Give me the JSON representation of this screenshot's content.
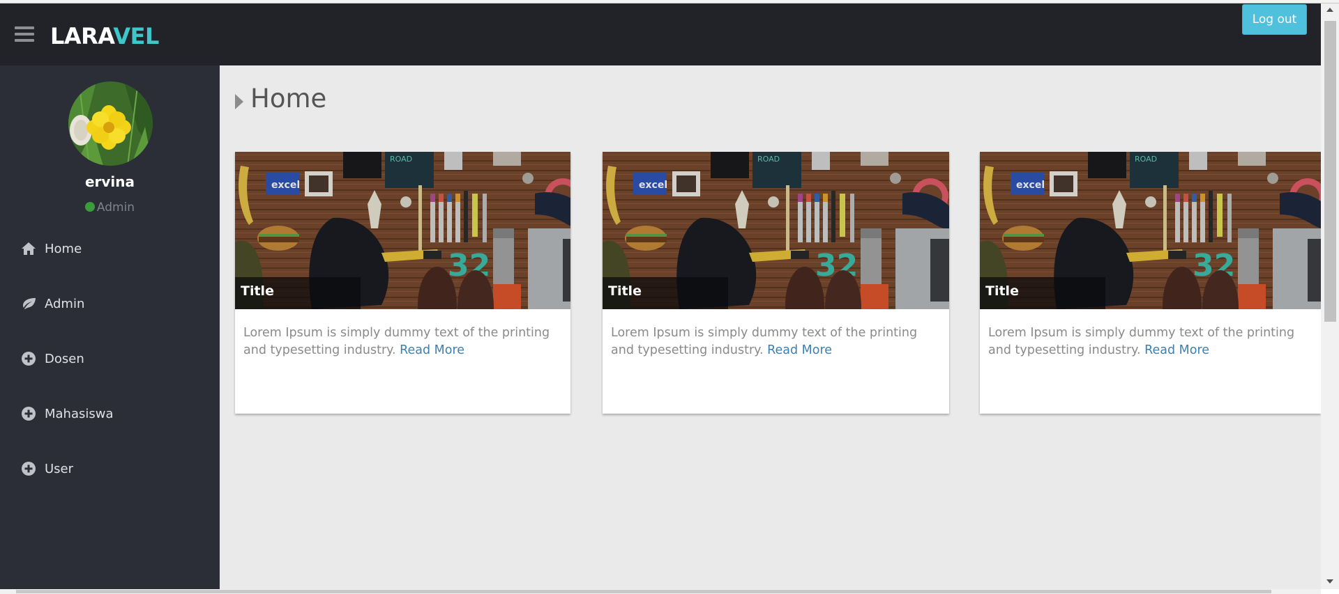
{
  "header": {
    "menu_icon": "hamburger-menu-icon",
    "brand_part1": "LARA",
    "brand_part2": "VEL",
    "brand_color_primary": "#ffffff",
    "brand_color_accent": "#3ec7c9",
    "logout_label": "Log out"
  },
  "sidebar": {
    "username": "ervina",
    "role": "Admin",
    "role_status_color": "#3a9c3a",
    "items": [
      {
        "label": "Home",
        "icon": "home-icon"
      },
      {
        "label": "Admin",
        "icon": "leaf-icon"
      },
      {
        "label": "Dosen",
        "icon": "plus-circle-icon"
      },
      {
        "label": "Mahasiswa",
        "icon": "plus-circle-icon"
      },
      {
        "label": "User",
        "icon": "plus-circle-icon"
      }
    ]
  },
  "main": {
    "page_title": "Home",
    "cards": [
      {
        "title": "Title",
        "text": "Lorem Ipsum is simply dummy text of the printing and typesetting industry.",
        "link": "Read More"
      },
      {
        "title": "Title",
        "text": "Lorem Ipsum is simply dummy text of the printing and typesetting industry.",
        "link": "Read More"
      },
      {
        "title": "Title",
        "text": "Lorem Ipsum is simply dummy text of the printing and typesetting industry.",
        "link": "Read More"
      }
    ]
  }
}
